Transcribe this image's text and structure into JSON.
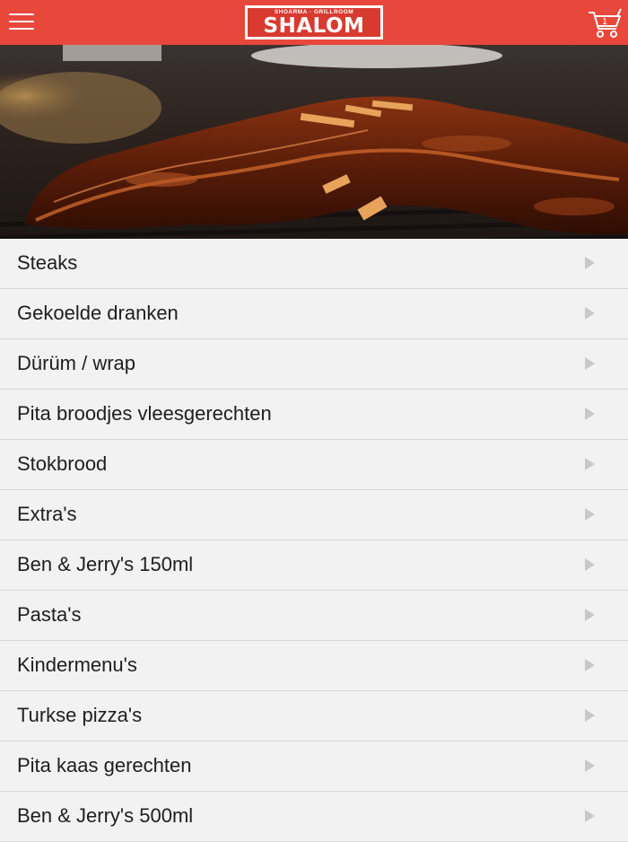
{
  "header": {
    "menu_icon": "hamburger-menu-icon",
    "logo_small": "SHOARMA · GRILLROOM",
    "logo_main": "SHALOM",
    "cart_icon": "shopping-cart-icon",
    "cart_count": "1",
    "bar_color": "#e8473b"
  },
  "hero": {
    "image": "grilled-spare-ribs-photo"
  },
  "categories": [
    {
      "label": "Steaks"
    },
    {
      "label": "Gekoelde dranken"
    },
    {
      "label": "Dürüm / wrap"
    },
    {
      "label": "Pita broodjes vleesgerechten"
    },
    {
      "label": "Stokbrood"
    },
    {
      "label": "Extra's"
    },
    {
      "label": "Ben & Jerry's 150ml"
    },
    {
      "label": "Pasta's"
    },
    {
      "label": "Kindermenu's"
    },
    {
      "label": "Turkse pizza's"
    },
    {
      "label": "Pita kaas gerechten"
    },
    {
      "label": "Ben & Jerry's 500ml"
    }
  ]
}
